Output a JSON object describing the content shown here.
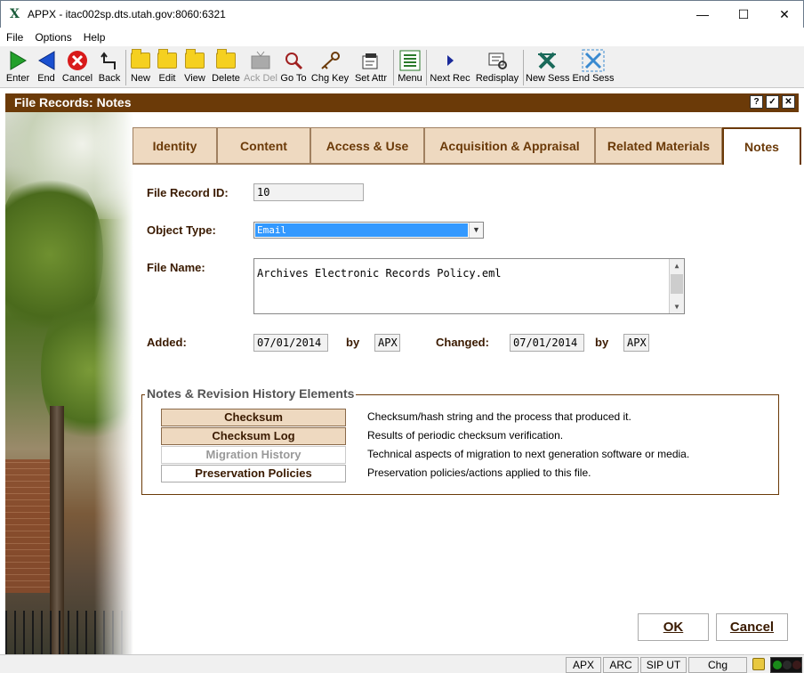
{
  "window": {
    "app_icon": "X",
    "title": "APPX - itac002sp.dts.utah.gov:8060:6321",
    "min": "—",
    "max": "☐",
    "close": "✕"
  },
  "menu": [
    "File",
    "Options",
    "Help"
  ],
  "toolbar": {
    "enter": "Enter",
    "end": "End",
    "cancel": "Cancel",
    "back": "Back",
    "new": "New",
    "edit": "Edit",
    "view": "View",
    "delete": "Delete",
    "ack_del": "Ack Del",
    "go_to": "Go To",
    "chg_key": "Chg Key",
    "set_attr": "Set Attr",
    "menu": "Menu",
    "next_rec": "Next Rec",
    "redisplay": "Redisplay",
    "new_sess": "New Sess",
    "end_sess": "End Sess"
  },
  "form": {
    "title": "File Records:  Notes",
    "help_btn": "?",
    "check_btn": "✓",
    "close_btn": "✕"
  },
  "tabs": [
    "Identity",
    "Content",
    "Access & Use",
    "Acquisition & Appraisal",
    "Related Materials",
    "Notes"
  ],
  "fields": {
    "file_record_id_label": "File Record ID:",
    "file_record_id": "10",
    "object_type_label": "Object Type:",
    "object_type": "Email",
    "file_name_label": "File Name:",
    "file_name": "Archives Electronic Records Policy.eml",
    "added_label": "Added:",
    "added_date": "07/01/2014",
    "by1": "by",
    "added_by": "APX",
    "changed_label": "Changed:",
    "changed_date": "07/01/2014",
    "by2": "by",
    "changed_by": "APX"
  },
  "notes_group": {
    "title": "Notes & Revision History Elements",
    "items": [
      {
        "label": "Checksum",
        "desc": "Checksum/hash string and the process that produced it."
      },
      {
        "label": "Checksum Log",
        "desc": "Results of periodic checksum verification."
      },
      {
        "label": "Migration History",
        "desc": "Technical aspects of migration to next generation software or media."
      },
      {
        "label": "Preservation Policies",
        "desc": "Preservation policies/actions applied to this file."
      }
    ]
  },
  "buttons": {
    "ok": "OK",
    "cancel": "Cancel"
  },
  "status": [
    "APX",
    "ARC",
    "SIP UT",
    "Chg"
  ]
}
